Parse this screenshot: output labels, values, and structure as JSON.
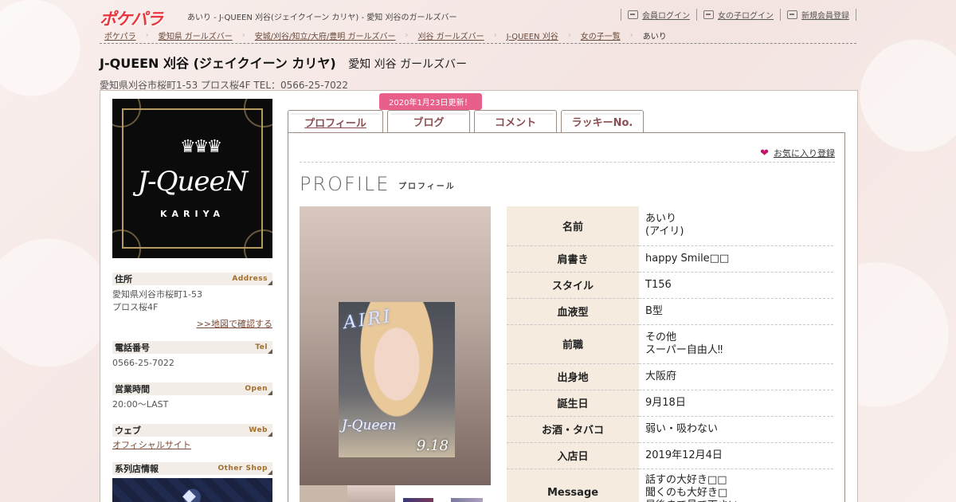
{
  "header": {
    "logo_text": "ポケパラ",
    "site_title": "あいり - J-QUEEN 刈谷(ジェイクイーン カリヤ) - 愛知 刈谷のガールズバー",
    "links": [
      {
        "label": "会員ログイン",
        "icon": "login-icon"
      },
      {
        "label": "女の子ログイン",
        "icon": "login-icon"
      },
      {
        "label": "新規会員登録",
        "icon": "register-icon"
      }
    ]
  },
  "breadcrumb": [
    "ポケパラ",
    "愛知県 ガールズバー",
    "安城/刈谷/知立/大府/豊明 ガールズバー",
    "刈谷 ガールズバー",
    "J-QUEEN 刈谷",
    "女の子一覧",
    "あいり"
  ],
  "shop": {
    "name": "J-QUEEN 刈谷 (ジェイクイーン カリヤ)",
    "area": "愛知 刈谷 ガールズバー",
    "address_line": "愛知県刈谷市桜町1-53 プロス桜4F TEL：0566-25-7022",
    "logo_brand": "J-QueeN",
    "logo_sub": "KARIYA",
    "logo_crown": "♛♛♛"
  },
  "sidebar": {
    "address": {
      "title": "住所",
      "en": "Address",
      "text": "愛知県刈谷市桜町1-53\nプロス桜4F",
      "link": ">>地図で確認する"
    },
    "tel": {
      "title": "電話番号",
      "en": "Tel",
      "text": "0566-25-7022"
    },
    "open": {
      "title": "営業時間",
      "en": "Open",
      "text": "20:00～LAST"
    },
    "web": {
      "title": "ウェブ",
      "en": "Web",
      "link": "オフィシャルサイト"
    },
    "other": {
      "title": "系列店情報",
      "en": "Other Shop"
    }
  },
  "tabs": {
    "update_badge": "2020年1月23日更新！",
    "items": [
      "プロフィール",
      "ブログ",
      "コメント",
      "ラッキーNo."
    ]
  },
  "profile": {
    "favorite_link": "お気に入り登録",
    "title": "PROFILE",
    "subtitle": "プロフィール",
    "photo_name": "AIRI",
    "photo_brand": "J-Queen",
    "photo_date": "9.18",
    "rows": [
      {
        "key": "名前",
        "value": "あいり\n(アイリ)"
      },
      {
        "key": "肩書き",
        "value": "happy Smile□□"
      },
      {
        "key": "スタイル",
        "value": "T156"
      },
      {
        "key": "血液型",
        "value": "B型"
      },
      {
        "key": "前職",
        "value": "その他\nスーパー自由人‼"
      },
      {
        "key": "出身地",
        "value": "大阪府"
      },
      {
        "key": "誕生日",
        "value": "9月18日"
      },
      {
        "key": "お酒・タバコ",
        "value": "弱い・吸わない"
      },
      {
        "key": "入店日",
        "value": "2019年12月4日"
      },
      {
        "key": "Message",
        "value": "話すの大好き□□\n聞くのも大好き□\n最後まで見て下さい"
      }
    ]
  },
  "colors": {
    "brand": "#e8373e",
    "badge": "#e8608a",
    "heart": "#c0166b",
    "tab_text": "#8a4e52"
  }
}
